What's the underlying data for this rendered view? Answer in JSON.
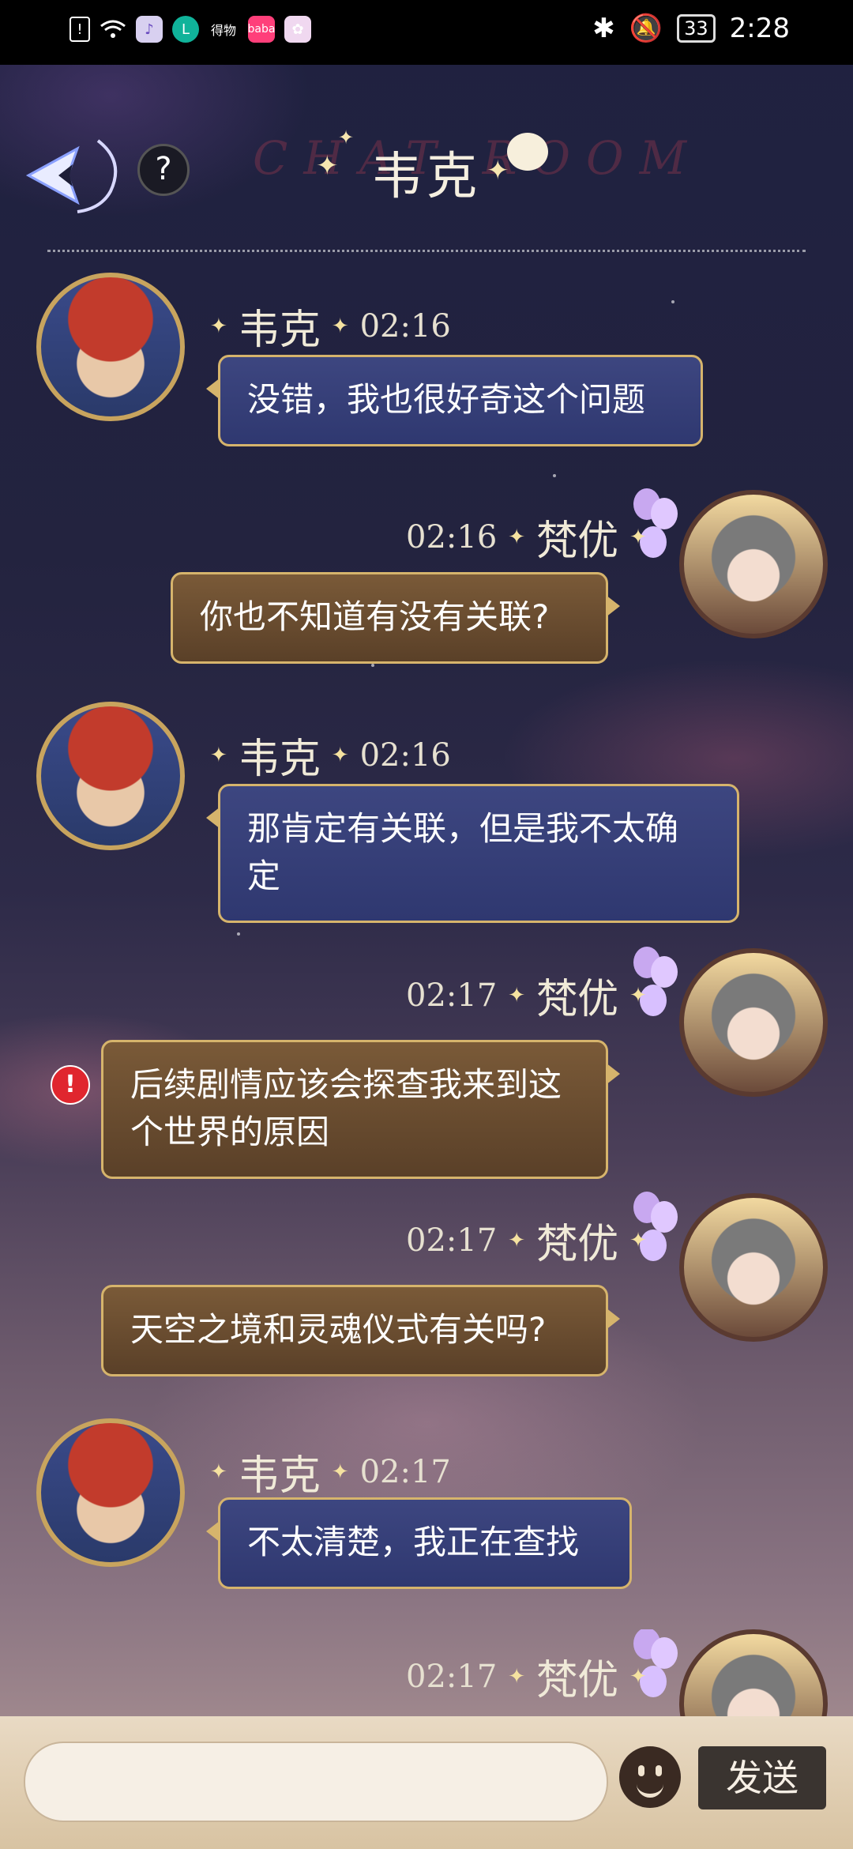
{
  "status_bar": {
    "time": "2:28",
    "battery": "33",
    "app_icons": [
      "sim-alert-icon",
      "wifi-icon",
      "music-icon",
      "l-app-icon",
      "dewu-icon",
      "baba-icon",
      "flower-app-icon"
    ],
    "app_labels": {
      "dewu": "得物",
      "baba": "baba"
    }
  },
  "header": {
    "title": "韦克",
    "bg_text": "CHAT ROOM",
    "help": "?"
  },
  "messages": [
    {
      "side": "in",
      "name": "韦克",
      "time": "02:16",
      "text": "没错，我也很好奇这个问题"
    },
    {
      "side": "out",
      "name": "梵优",
      "time": "02:16",
      "text": "你也不知道有没有关联?"
    },
    {
      "side": "in",
      "name": "韦克",
      "time": "02:16",
      "text": "那肯定有关联，但是我不太确定"
    },
    {
      "side": "out",
      "name": "梵优",
      "time": "02:17",
      "text": "后续剧情应该会探查我来到这个世界的原因",
      "error": "!"
    },
    {
      "side": "out",
      "name": "梵优",
      "time": "02:17",
      "text": "天空之境和灵魂仪式有关吗?"
    },
    {
      "side": "in",
      "name": "韦克",
      "time": "02:17",
      "text": "不太清楚，我正在查找"
    },
    {
      "side": "out",
      "name": "梵优",
      "time": "02:17",
      "text": ""
    }
  ],
  "input": {
    "placeholder": "",
    "send_label": "发送"
  }
}
